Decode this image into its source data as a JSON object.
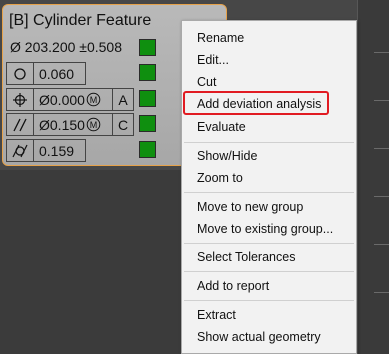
{
  "feature": {
    "title": "[B] Cylinder Feature",
    "diameter_value": "Ø 203.200 ±0.508",
    "rows": [
      {
        "symbol": "circularity-icon",
        "value": "0.060",
        "datum": "",
        "status_color": "#0f8f0f"
      },
      {
        "symbol": "position-icon",
        "value": "Ø0.000",
        "modifier": "M",
        "datum": "A",
        "status_color": "#0f8f0f"
      },
      {
        "symbol": "parallelism-icon",
        "value": "Ø0.150",
        "modifier": "M",
        "datum": "C",
        "status_color": "#0f8f0f"
      },
      {
        "symbol": "cylindricity-icon",
        "value": "0.159",
        "datum": "",
        "status_color": "#0f8f0f"
      }
    ],
    "diameter_status_color": "#0f8f0f"
  },
  "context_menu": {
    "items": [
      "Rename",
      "Edit...",
      "Cut",
      "Add deviation analysis",
      "Evaluate",
      "Show/Hide",
      "Zoom to",
      "Move to new group",
      "Move to existing group...",
      "Select Tolerances",
      "Add to report",
      "Extract",
      "Show actual geometry"
    ],
    "highlighted_item": "Add deviation analysis",
    "highlight_color": "#e11b22"
  }
}
